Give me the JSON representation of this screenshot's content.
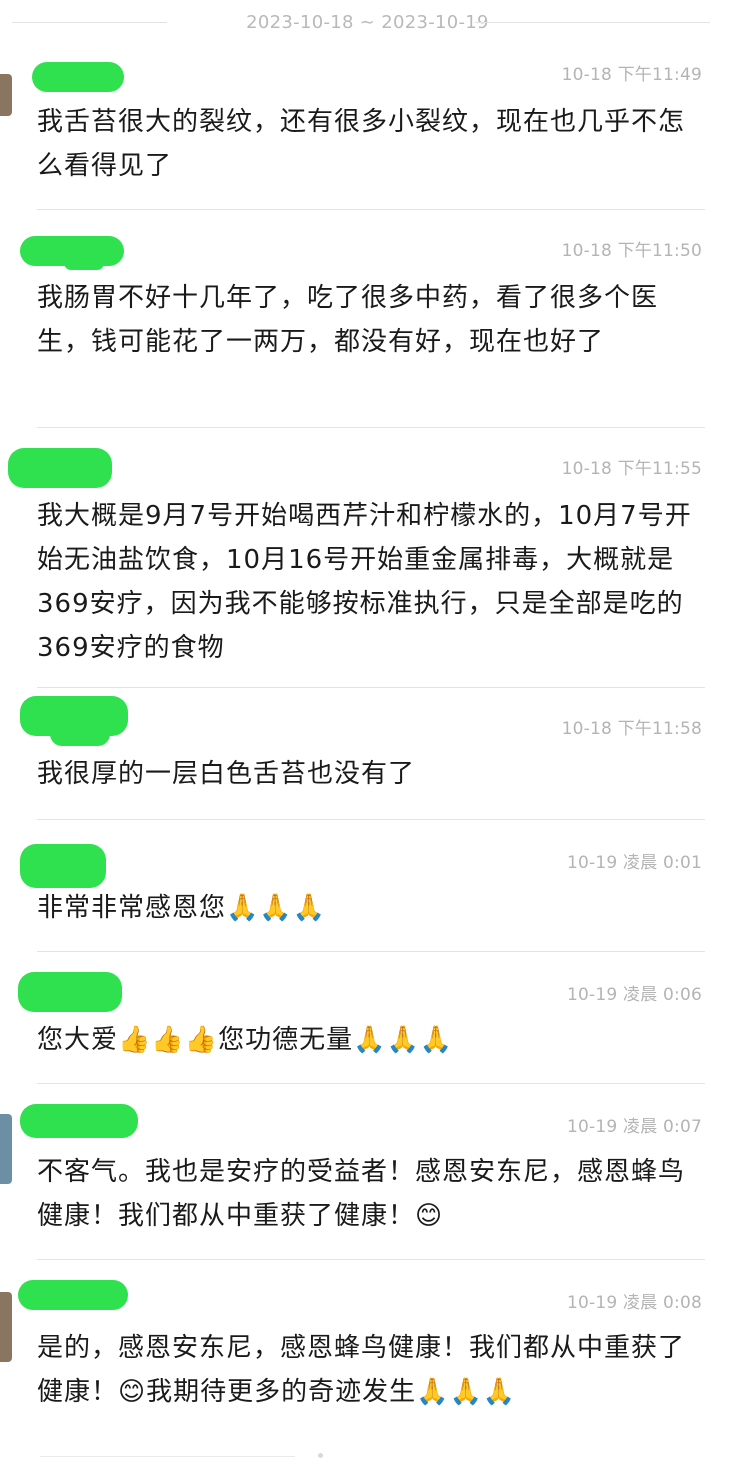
{
  "date_range": "2023-10-18 ~ 2023-10-19",
  "messages": [
    {
      "time": "10-18 下午11:49",
      "text": "我舌苔很大的裂纹，还有很多小裂纹，现在也几乎不怎么看得见了"
    },
    {
      "time": "10-18 下午11:50",
      "text": "我肠胃不好十几年了，吃了很多中药，看了很多个医生，钱可能花了一两万，都没有好，现在也好了"
    },
    {
      "time": "10-18 下午11:55",
      "text": "我大概是9月7号开始喝西芹汁和柠檬水的，10月7号开始无油盐饮食，10月16号开始重金属排毒，大概就是369安疗，因为我不能够按标准执行，只是全部是吃的369安疗的食物"
    },
    {
      "time": "10-18 下午11:58",
      "text": "我很厚的一层白色舌苔也没有了"
    },
    {
      "time": "10-19 凌晨 0:01",
      "text": "非常非常感恩您🙏🙏🙏"
    },
    {
      "time": "10-19 凌晨 0:06",
      "text": "您大爱👍👍👍您功德无量🙏🙏🙏"
    },
    {
      "time": "10-19 凌晨 0:07",
      "text": "不客气。我也是安疗的受益者！感恩安东尼，感恩蜂鸟健康！我们都从中重获了健康！😊"
    },
    {
      "time": "10-19 凌晨 0:08",
      "text": "是的，感恩安东尼，感恩蜂鸟健康！我们都从中重获了健康！😊我期待更多的奇迹发生🙏🙏🙏"
    }
  ],
  "colors": {
    "name_redaction": "#2fe14f",
    "timestamp": "#b4b4b4",
    "separator": "#e3e3e3"
  }
}
